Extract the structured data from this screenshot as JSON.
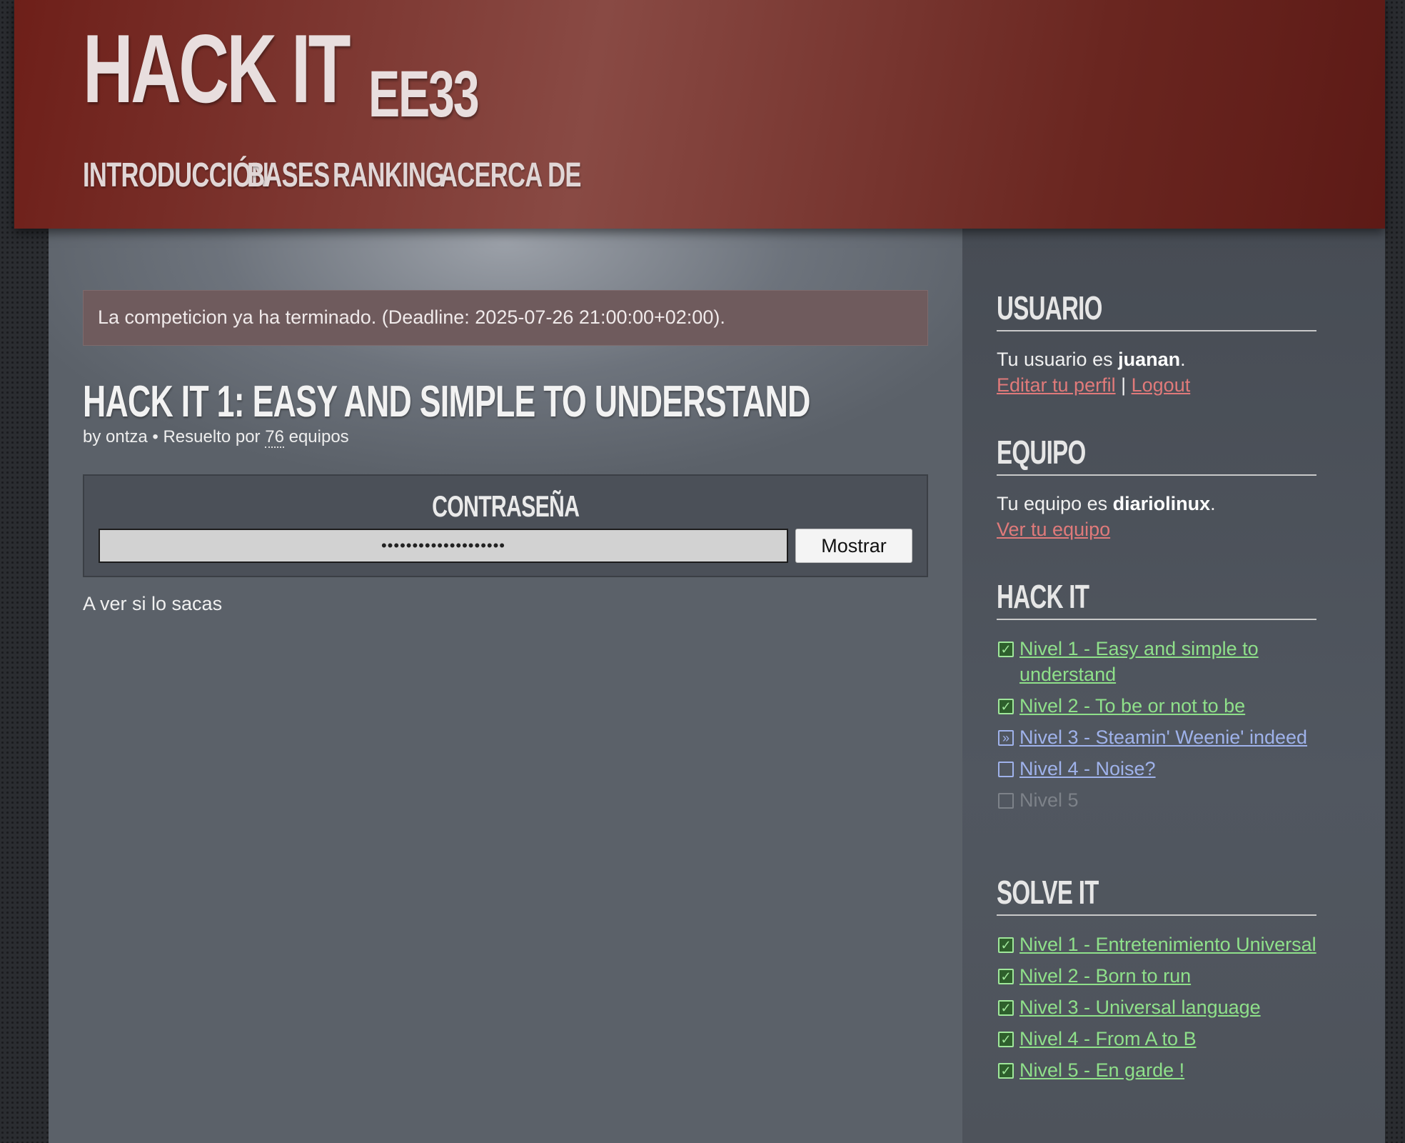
{
  "header": {
    "logo_main": "HACK IT",
    "logo_sub": "EE33",
    "nav": [
      "INTRODUCCIÓN",
      "BASES",
      "RANKING",
      "ACERCA DE"
    ]
  },
  "main": {
    "notice": "La competicion ya ha terminado. (Deadline: 2025-07-26 21:00:00+02:00).",
    "title": "HACK IT 1: EASY AND SIMPLE TO UNDERSTAND",
    "byline_prefix": "by ontza • Resuelto por",
    "solved_count": "76",
    "byline_suffix": "equipos",
    "password_label": "CONTRASEÑA",
    "password_value": "••••••••••••••••••••",
    "show_button": "Mostrar",
    "description": "A ver si lo sacas"
  },
  "sidebar": {
    "user_heading": "USUARIO",
    "user_text": "Tu usuario es",
    "username": "juanan",
    "edit_profile": "Editar tu perfil",
    "separator": "|",
    "logout": "Logout",
    "team_heading": "EQUIPO",
    "team_text": "Tu equipo es",
    "team_name": "diariolinux",
    "view_team": "Ver tu equipo",
    "hackit_heading": "HACK IT",
    "hackit_levels": [
      {
        "label": "Nivel 1 - Easy and simple to understand",
        "status": "solved"
      },
      {
        "label": "Nivel 2 - To be or not to be",
        "status": "solved"
      },
      {
        "label": "Nivel 3 - Steamin' Weenie' indeed",
        "status": "current"
      },
      {
        "label": "Nivel 4 - Noise?",
        "status": "open"
      },
      {
        "label": "Nivel 5",
        "status": "locked"
      }
    ],
    "solveit_heading": "SOLVE IT",
    "solveit_levels": [
      {
        "label": "Nivel 1 - Entretenimiento Universal",
        "status": "solved"
      },
      {
        "label": "Nivel 2 - Born to run",
        "status": "solved"
      },
      {
        "label": "Nivel 3 - Universal language",
        "status": "solved"
      },
      {
        "label": "Nivel 4 - From A to B",
        "status": "solved"
      },
      {
        "label": "Nivel 5 - En garde !",
        "status": "solved"
      }
    ]
  },
  "colors": {
    "header": "#894a44",
    "solved": "#8fe08a",
    "link": "#9fb2ea",
    "red_link": "#e07a7a"
  }
}
